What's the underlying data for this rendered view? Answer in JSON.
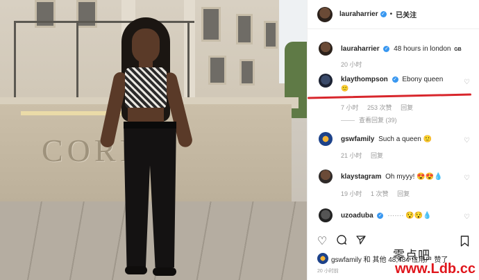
{
  "header": {
    "username": "lauraharrier",
    "separator": "•",
    "follow_label": "已关注"
  },
  "caption": {
    "username": "lauraharrier",
    "text": "48 hours in london",
    "suffix": "GB",
    "time": "20 小时"
  },
  "comments": [
    {
      "username": "klaythompson",
      "verified": true,
      "text": "Ebony queen",
      "emoji": "🙂",
      "time": "7 小时",
      "likes": "253 次赞",
      "reply": "回复",
      "view_replies": "查看回复 (39)"
    },
    {
      "username": "gswfamily",
      "verified": false,
      "text": "Such a queen",
      "emoji": "🙂",
      "time": "21 小时",
      "reply": "回复"
    },
    {
      "username": "klaystagram",
      "verified": false,
      "text": "Oh myyy!",
      "emoji": "😍😍💧",
      "time": "19 小时",
      "likes": "1 次赞",
      "reply": "回复"
    },
    {
      "username": "uzoaduba",
      "verified": true,
      "text": "·······",
      "emoji": "😯😯💧"
    }
  ],
  "actions": {
    "icons": [
      "heart-icon",
      "comment-icon",
      "share-icon",
      "bookmark-icon"
    ]
  },
  "likes_line": {
    "text": "gswfamily 和 其他 48,484 位用户 赞了"
  },
  "post_time": "20 小时前",
  "photo": {
    "engraving": "CORI"
  },
  "watermark": {
    "cn": "零点吧",
    "url": "www.Ldb.cc"
  },
  "colors": {
    "verified": "#3897f0",
    "annotation": "#d8262c",
    "watermark_url": "#e0161c"
  }
}
